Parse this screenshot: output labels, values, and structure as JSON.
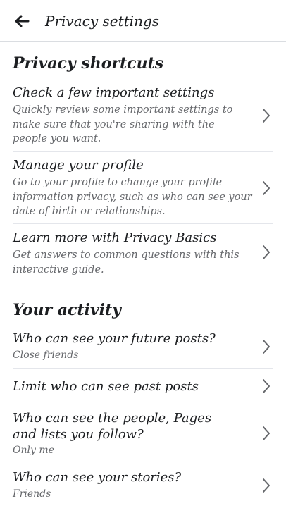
{
  "header": {
    "title": "Privacy settings",
    "back_icon": "back-arrow-icon"
  },
  "privacy_shortcuts": {
    "heading": "Privacy shortcuts",
    "items": [
      {
        "title": "Check a few important settings",
        "description": "Quickly review some important settings to make sure that you're sharing with the people you want."
      },
      {
        "title": "Manage your profile",
        "description": "Go to your profile to change your profile information privacy, such as who can see your date of birth or relationships."
      },
      {
        "title": "Learn more with Privacy Basics",
        "description": "Get answers to common questions with this interactive guide."
      }
    ]
  },
  "your_activity": {
    "heading": "Your activity",
    "items": [
      {
        "title": "Who can see your future posts?",
        "value": "Close friends"
      },
      {
        "title": "Limit who can see past posts",
        "value": ""
      },
      {
        "title": "Who can see the people, Pages and lists you follow?",
        "value": "Only me"
      },
      {
        "title": "Who can see your stories?",
        "value": "Friends"
      }
    ]
  }
}
